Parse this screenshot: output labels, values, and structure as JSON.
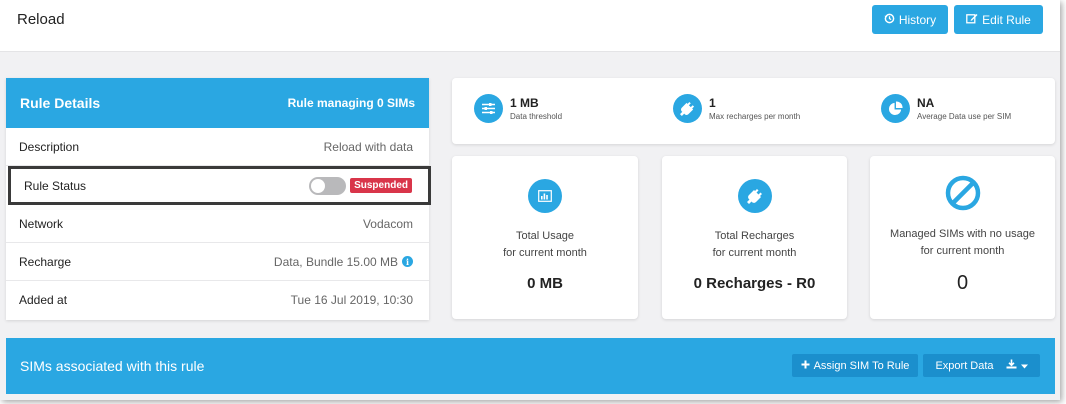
{
  "header": {
    "title": "Reload",
    "history_label": "History",
    "edit_label": "Edit Rule"
  },
  "rule_details": {
    "title": "Rule Details",
    "subtitle": "Rule managing 0 SIMs",
    "rows": [
      {
        "label": "Description",
        "value": "Reload with data"
      },
      {
        "label": "Rule Status",
        "status_badge": "Suspended",
        "toggle_on": false
      },
      {
        "label": "Network",
        "value": "Vodacom"
      },
      {
        "label": "Recharge",
        "value": "Data, Bundle 15.00 MB"
      },
      {
        "label": "Added at",
        "value": "Tue 16 Jul 2019, 10:30"
      }
    ]
  },
  "stats": [
    {
      "value": "1 MB",
      "desc": "Data threshold",
      "icon": "sliders-icon"
    },
    {
      "value": "1",
      "desc": "Max recharges per month",
      "icon": "plug-icon"
    },
    {
      "value": "NA",
      "desc": "Average Data use per SIM",
      "icon": "pie-chart-icon"
    }
  ],
  "metrics": [
    {
      "line1": "Total Usage",
      "line2": "for current month",
      "value": "0 MB",
      "icon": "bar-chart-icon"
    },
    {
      "line1": "Total Recharges",
      "line2": "for current month",
      "value": "0 Recharges - R0",
      "icon": "plug-icon"
    },
    {
      "line1": "Managed SIMs with no usage",
      "line2": "for current month",
      "value": "0",
      "icon": "ban-icon"
    }
  ],
  "sims": {
    "title": "SIMs associated with this rule",
    "assign_label": "Assign SIM To Rule",
    "export_label": "Export Data"
  },
  "colors": {
    "accent": "#2aa7e2",
    "danger": "#d9354a",
    "background": "#f1f1f3"
  }
}
